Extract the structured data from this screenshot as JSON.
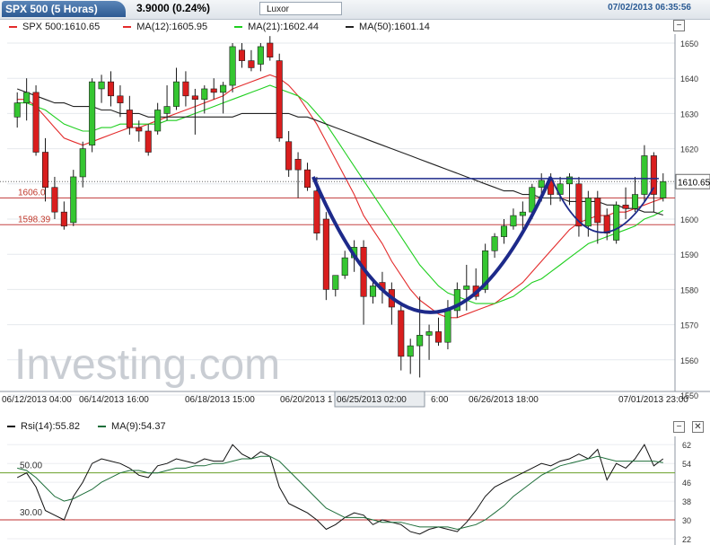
{
  "header": {
    "title": "SPX 500 (5 Horas)",
    "change": "3.9000 (0.24%)",
    "theme": "Luxor",
    "datetime": "07/02/2013 06:35:56"
  },
  "legend": {
    "price": "SPX 500:1610.65",
    "ma12": "MA(12):1605.95",
    "ma21": "MA(21):1602.44",
    "ma50": "MA(50):1601.14"
  },
  "watermark": "Investing.com",
  "chart_data": [
    {
      "type": "candlestick",
      "title": "SPX 500 (5 Horas)",
      "ylim": [
        1550,
        1650
      ],
      "yticks": [
        1550,
        1560,
        1570,
        1580,
        1590,
        1600,
        1610,
        1620,
        1630,
        1640,
        1650
      ],
      "xtick_labels": [
        "06/12/2013 04:00",
        "06/14/2013 16:00",
        "06/18/2013 15:00",
        "06/20/2013 1",
        "06/25/2013 02:00",
        "6:00",
        "06/26/2013 18:00",
        "07/01/2013 23:00"
      ],
      "last_price": "1610.65",
      "levels": [
        {
          "value": 1606,
          "label": "1606.0"
        },
        {
          "value": 1598.39,
          "label": "1598.39"
        }
      ],
      "candles": [
        {
          "o": 1629,
          "h": 1636,
          "l": 1626,
          "c": 1633
        },
        {
          "o": 1633,
          "h": 1640,
          "l": 1628,
          "c": 1636
        },
        {
          "o": 1636,
          "h": 1638,
          "l": 1618,
          "c": 1619
        },
        {
          "o": 1619,
          "h": 1623,
          "l": 1605,
          "c": 1609
        },
        {
          "o": 1609,
          "h": 1612,
          "l": 1600,
          "c": 1602
        },
        {
          "o": 1602,
          "h": 1605,
          "l": 1597,
          "c": 1598
        },
        {
          "o": 1599,
          "h": 1614,
          "l": 1598,
          "c": 1612
        },
        {
          "o": 1612,
          "h": 1622,
          "l": 1609,
          "c": 1620
        },
        {
          "o": 1621,
          "h": 1640,
          "l": 1619,
          "c": 1639
        },
        {
          "o": 1637,
          "h": 1641,
          "l": 1633,
          "c": 1639
        },
        {
          "o": 1639,
          "h": 1642,
          "l": 1632,
          "c": 1635
        },
        {
          "o": 1635,
          "h": 1638,
          "l": 1629,
          "c": 1633
        },
        {
          "o": 1631,
          "h": 1635,
          "l": 1624,
          "c": 1626
        },
        {
          "o": 1626,
          "h": 1628,
          "l": 1622,
          "c": 1625
        },
        {
          "o": 1625,
          "h": 1627,
          "l": 1618,
          "c": 1619
        },
        {
          "o": 1625,
          "h": 1633,
          "l": 1624,
          "c": 1631
        },
        {
          "o": 1630,
          "h": 1638,
          "l": 1628,
          "c": 1632
        },
        {
          "o": 1632,
          "h": 1643,
          "l": 1631,
          "c": 1639
        },
        {
          "o": 1639,
          "h": 1642,
          "l": 1632,
          "c": 1635
        },
        {
          "o": 1635,
          "h": 1637,
          "l": 1624,
          "c": 1634
        },
        {
          "o": 1634,
          "h": 1638,
          "l": 1630,
          "c": 1637
        },
        {
          "o": 1637,
          "h": 1640,
          "l": 1634,
          "c": 1636
        },
        {
          "o": 1636,
          "h": 1639,
          "l": 1630,
          "c": 1638
        },
        {
          "o": 1638,
          "h": 1650,
          "l": 1636,
          "c": 1649
        },
        {
          "o": 1648,
          "h": 1650,
          "l": 1643,
          "c": 1645
        },
        {
          "o": 1645,
          "h": 1648,
          "l": 1642,
          "c": 1643
        },
        {
          "o": 1644,
          "h": 1650,
          "l": 1642,
          "c": 1649
        },
        {
          "o": 1650,
          "h": 1652,
          "l": 1645,
          "c": 1646
        },
        {
          "o": 1645,
          "h": 1647,
          "l": 1622,
          "c": 1623
        },
        {
          "o": 1622,
          "h": 1625,
          "l": 1612,
          "c": 1614
        },
        {
          "o": 1617,
          "h": 1619,
          "l": 1606,
          "c": 1614
        },
        {
          "o": 1614,
          "h": 1616,
          "l": 1608,
          "c": 1609
        },
        {
          "o": 1608,
          "h": 1612,
          "l": 1594,
          "c": 1596
        },
        {
          "o": 1600,
          "h": 1602,
          "l": 1577,
          "c": 1580
        },
        {
          "o": 1580,
          "h": 1584,
          "l": 1578,
          "c": 1584
        },
        {
          "o": 1584,
          "h": 1591,
          "l": 1583,
          "c": 1589
        },
        {
          "o": 1589,
          "h": 1594,
          "l": 1585,
          "c": 1592
        },
        {
          "o": 1592,
          "h": 1594,
          "l": 1570,
          "c": 1578
        },
        {
          "o": 1578,
          "h": 1583,
          "l": 1576,
          "c": 1581
        },
        {
          "o": 1582,
          "h": 1585,
          "l": 1576,
          "c": 1580
        },
        {
          "o": 1580,
          "h": 1582,
          "l": 1570,
          "c": 1575
        },
        {
          "o": 1574,
          "h": 1576,
          "l": 1557,
          "c": 1561
        },
        {
          "o": 1561,
          "h": 1566,
          "l": 1556,
          "c": 1564
        },
        {
          "o": 1564,
          "h": 1578,
          "l": 1555,
          "c": 1567
        },
        {
          "o": 1567,
          "h": 1570,
          "l": 1560,
          "c": 1568
        },
        {
          "o": 1568,
          "h": 1572,
          "l": 1564,
          "c": 1565
        },
        {
          "o": 1565,
          "h": 1577,
          "l": 1563,
          "c": 1574
        },
        {
          "o": 1574,
          "h": 1582,
          "l": 1572,
          "c": 1580
        },
        {
          "o": 1580,
          "h": 1587,
          "l": 1574,
          "c": 1581
        },
        {
          "o": 1581,
          "h": 1586,
          "l": 1577,
          "c": 1578
        },
        {
          "o": 1580,
          "h": 1593,
          "l": 1579,
          "c": 1591
        },
        {
          "o": 1591,
          "h": 1596,
          "l": 1589,
          "c": 1595
        },
        {
          "o": 1595,
          "h": 1600,
          "l": 1593,
          "c": 1598
        },
        {
          "o": 1598,
          "h": 1603,
          "l": 1597,
          "c": 1601
        },
        {
          "o": 1601,
          "h": 1605,
          "l": 1597,
          "c": 1602
        },
        {
          "o": 1602,
          "h": 1610,
          "l": 1600,
          "c": 1609
        },
        {
          "o": 1609,
          "h": 1613,
          "l": 1605,
          "c": 1611
        },
        {
          "o": 1611,
          "h": 1613,
          "l": 1604,
          "c": 1607
        },
        {
          "o": 1607,
          "h": 1612,
          "l": 1605,
          "c": 1610
        },
        {
          "o": 1610,
          "h": 1613,
          "l": 1604,
          "c": 1612
        },
        {
          "o": 1610,
          "h": 1612,
          "l": 1595,
          "c": 1598
        },
        {
          "o": 1598,
          "h": 1608,
          "l": 1595,
          "c": 1606
        },
        {
          "o": 1606,
          "h": 1608,
          "l": 1593,
          "c": 1599
        },
        {
          "o": 1601,
          "h": 1603,
          "l": 1594,
          "c": 1596
        },
        {
          "o": 1594,
          "h": 1605,
          "l": 1593,
          "c": 1604
        },
        {
          "o": 1604,
          "h": 1609,
          "l": 1600,
          "c": 1603
        },
        {
          "o": 1603,
          "h": 1612,
          "l": 1602,
          "c": 1607
        },
        {
          "o": 1607,
          "h": 1621,
          "l": 1605,
          "c": 1618
        },
        {
          "o": 1618,
          "h": 1619,
          "l": 1602,
          "c": 1607
        },
        {
          "o": 1606,
          "h": 1613,
          "l": 1605,
          "c": 1610.65
        }
      ],
      "series": [
        {
          "name": "MA(12)",
          "color": "#e32b2b",
          "values": [
            1634,
            1634,
            1632,
            1629,
            1626,
            1623,
            1622,
            1621,
            1622,
            1623,
            1624,
            1625,
            1626,
            1626,
            1627,
            1628,
            1629,
            1630,
            1631,
            1632,
            1633,
            1634,
            1635,
            1637,
            1638,
            1639,
            1640,
            1641,
            1640,
            1638,
            1635,
            1631,
            1627,
            1622,
            1617,
            1612,
            1607,
            1601,
            1597,
            1593,
            1588,
            1584,
            1580,
            1577,
            1575,
            1573,
            1572,
            1572,
            1573,
            1574,
            1575,
            1576,
            1578,
            1580,
            1582,
            1585,
            1588,
            1591,
            1594,
            1597,
            1599,
            1600,
            1601,
            1601,
            1602,
            1602,
            1603,
            1604,
            1605,
            1605.95
          ]
        },
        {
          "name": "MA(21)",
          "color": "#1fcf1f",
          "values": [
            1633,
            1633,
            1632,
            1631,
            1629,
            1627,
            1626,
            1625,
            1625,
            1626,
            1626,
            1627,
            1627,
            1627,
            1627,
            1627,
            1628,
            1628,
            1629,
            1630,
            1631,
            1632,
            1633,
            1634,
            1635,
            1636,
            1637,
            1638,
            1637,
            1636,
            1635,
            1633,
            1630,
            1627,
            1623,
            1619,
            1615,
            1611,
            1607,
            1603,
            1599,
            1595,
            1591,
            1587,
            1584,
            1581,
            1579,
            1578,
            1577,
            1576,
            1576,
            1576,
            1577,
            1578,
            1580,
            1582,
            1583,
            1585,
            1587,
            1589,
            1591,
            1593,
            1594,
            1595,
            1596,
            1597,
            1598,
            1600,
            1601,
            1602.44
          ]
        },
        {
          "name": "MA(50)",
          "color": "#222222",
          "values": [
            1637,
            1636,
            1635,
            1634,
            1633,
            1633,
            1632,
            1632,
            1632,
            1631,
            1631,
            1630,
            1630,
            1630,
            1629,
            1629,
            1629,
            1629,
            1629,
            1629,
            1629,
            1629,
            1629,
            1629,
            1630,
            1630,
            1630,
            1630,
            1630,
            1630,
            1629,
            1629,
            1628,
            1627,
            1626,
            1625,
            1624,
            1623,
            1622,
            1621,
            1620,
            1619,
            1618,
            1617,
            1616,
            1615,
            1614,
            1613,
            1612,
            1611,
            1610,
            1609,
            1608,
            1608,
            1607,
            1607,
            1606,
            1606,
            1606,
            1605,
            1605,
            1605,
            1605,
            1604,
            1604,
            1603,
            1603,
            1602,
            1602,
            1601.14
          ]
        }
      ]
    },
    {
      "type": "line",
      "title": "Rsi(14)",
      "ylim": [
        22,
        64
      ],
      "yticks": [
        22,
        30,
        38,
        46,
        54,
        62
      ],
      "levels": [
        {
          "value": 30,
          "label": "30.00"
        },
        {
          "value": 50,
          "label": "50.00"
        }
      ],
      "series": [
        {
          "name": "Rsi(14)",
          "color": "#111111",
          "value": "55.82",
          "values": [
            48,
            50,
            44,
            34,
            32,
            30,
            40,
            46,
            54,
            56,
            55,
            54,
            52,
            49,
            48,
            53,
            54,
            56,
            55,
            54,
            56,
            55,
            55,
            62,
            58,
            56,
            59,
            57,
            44,
            37,
            35,
            33,
            30,
            26,
            28,
            31,
            33,
            32,
            28,
            30,
            29,
            28,
            25,
            24,
            26,
            27,
            26,
            25,
            29,
            34,
            40,
            44,
            46,
            48,
            50,
            52,
            54,
            53,
            55,
            56,
            58,
            56,
            60,
            47,
            54,
            52,
            56,
            62,
            53,
            56
          ]
        },
        {
          "name": "MA(9)",
          "color": "#1e6e3a",
          "value": "54.37",
          "values": [
            52,
            51,
            48,
            44,
            40,
            38,
            39,
            41,
            43,
            46,
            48,
            50,
            51,
            51,
            50,
            50,
            51,
            52,
            52,
            53,
            53,
            54,
            54,
            55,
            56,
            56,
            57,
            57,
            55,
            51,
            47,
            43,
            39,
            35,
            33,
            31,
            31,
            31,
            30,
            29,
            29,
            29,
            28,
            27,
            27,
            27,
            27,
            26,
            27,
            28,
            30,
            33,
            36,
            40,
            43,
            46,
            49,
            51,
            53,
            54,
            55,
            56,
            57,
            56,
            55,
            55,
            55,
            55,
            55,
            54.37
          ]
        }
      ]
    }
  ],
  "rsi_legend": {
    "rsi": "Rsi(14):55.82",
    "ma9": "MA(9):54.37"
  }
}
